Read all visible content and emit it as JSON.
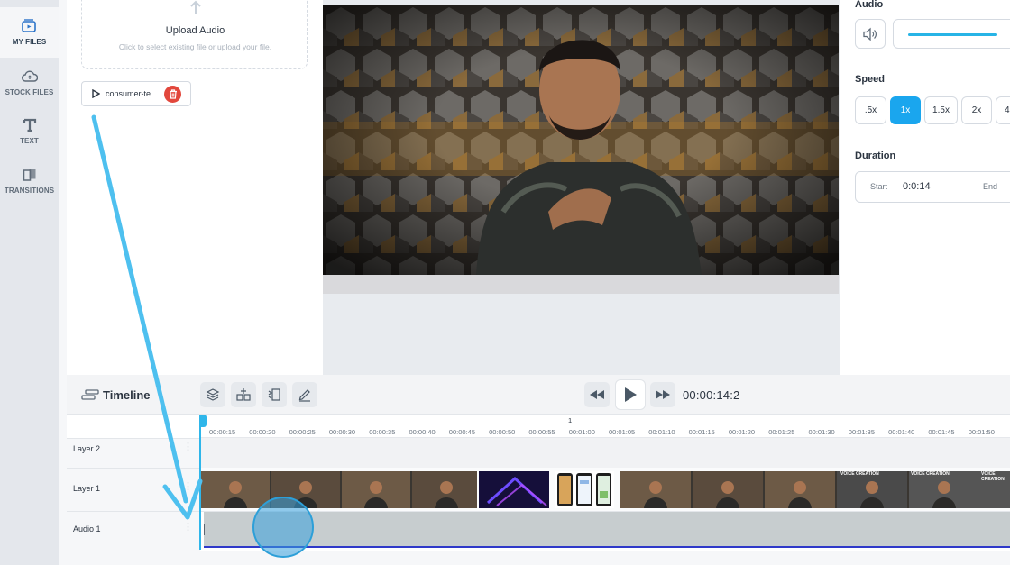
{
  "rail": {
    "items": [
      {
        "label": "MY FILES",
        "icon": "video-file-icon"
      },
      {
        "label": "STOCK FILES",
        "icon": "cloud-icon"
      },
      {
        "label": "TEXT",
        "icon": "text-t-icon"
      },
      {
        "label": "TRANSITIONS",
        "icon": "transition-icon"
      }
    ]
  },
  "files": {
    "upload_title": "Upload Audio",
    "upload_subtitle": "Click to select existing file or upload your file.",
    "file_chip_name": "consumer-te..."
  },
  "settings": {
    "audio_label": "Audio",
    "volume_level": 0.85,
    "speed_label": "Speed",
    "speeds": [
      ".5x",
      "1x",
      "1.5x",
      "2x",
      "4"
    ],
    "active_speed": "1x",
    "duration_label": "Duration",
    "start_label": "Start",
    "start_value": "0:0:14",
    "end_label": "End"
  },
  "timeline": {
    "title": "Timeline",
    "timecode": "00:00:14:2",
    "minute_marker": "1",
    "ticks": [
      "00:00:15",
      "00:00:20",
      "00:00:25",
      "00:00:30",
      "00:00:35",
      "00:00:40",
      "00:00:45",
      "00:00:50",
      "00:00:55",
      "00:01:00",
      "00:01:05",
      "00:01:10",
      "00:01:15",
      "00:01:20",
      "00:01:25",
      "00:01:30",
      "00:01:35",
      "00:01:40",
      "00:01:45",
      "00:01:50"
    ],
    "layers": [
      "Layer 2",
      "Layer 1",
      "Audio 1"
    ],
    "clip_caption": "VOICE CREATION"
  },
  "colors": {
    "accent": "#1aa6ee",
    "delete": "#e2473c",
    "audio_border": "#2f39c9"
  }
}
